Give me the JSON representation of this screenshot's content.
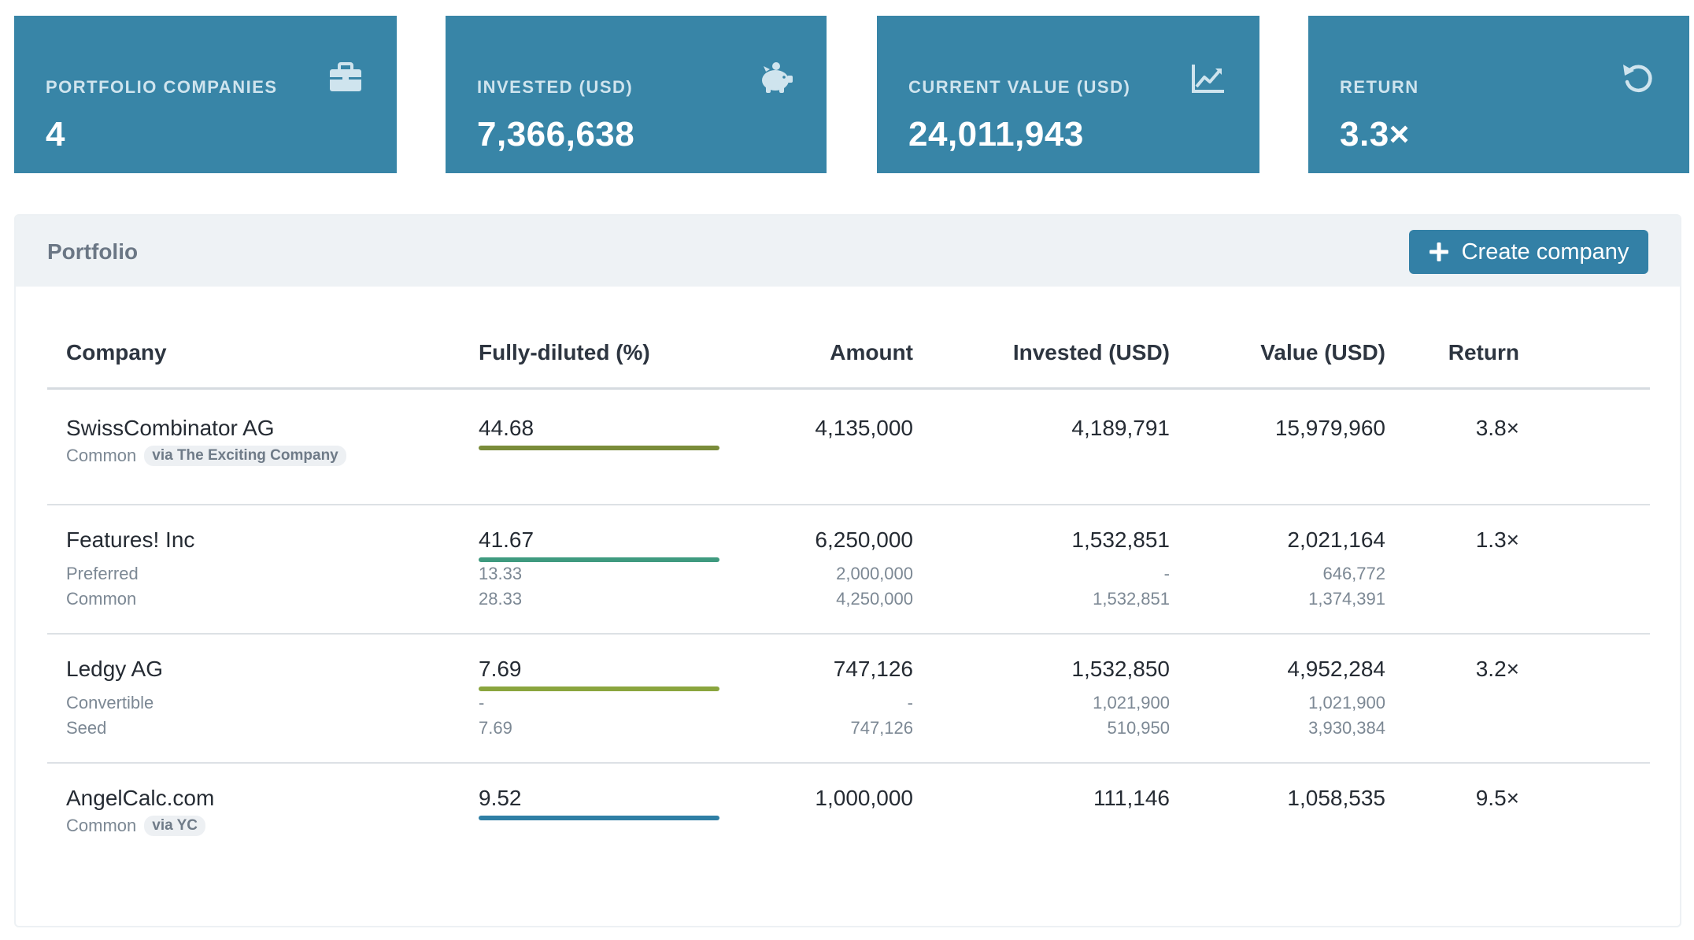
{
  "stats": {
    "companies": {
      "label": "PORTFOLIO COMPANIES",
      "value": "4",
      "icon": "briefcase-icon"
    },
    "invested": {
      "label": "INVESTED (USD)",
      "value": "7,366,638",
      "icon": "piggy-bank-icon"
    },
    "current": {
      "label": "CURRENT VALUE (USD)",
      "value": "24,011,943",
      "icon": "area-chart-icon"
    },
    "ret": {
      "label": "RETURN",
      "value": "3.3×",
      "icon": "refresh-icon"
    }
  },
  "portfolio": {
    "title": "Portfolio",
    "create_label": "Create company",
    "columns": {
      "company": "Company",
      "fd": "Fully-diluted (%)",
      "amount": "Amount",
      "invested": "Invested (USD)",
      "value": "Value (USD)",
      "ret": "Return"
    },
    "rows": [
      {
        "name": "SwissCombinator AG",
        "fd": "44.68",
        "fd_fraction": 0.4468,
        "bar_color": "#7a8c3a",
        "amount": "4,135,000",
        "invested": "4,189,791",
        "value": "15,979,960",
        "ret": "3.8×",
        "sub": [
          {
            "label": "Common",
            "via": "via The Exciting Company"
          }
        ]
      },
      {
        "name": "Features! Inc",
        "fd": "41.67",
        "fd_fraction": 0.4167,
        "bar_color": "#3f9a7f",
        "amount": "6,250,000",
        "invested": "1,532,851",
        "value": "2,021,164",
        "ret": "1.3×",
        "sub": [
          {
            "label": "Preferred",
            "fd": "13.33",
            "amount": "2,000,000",
            "invested": "-",
            "value": "646,772"
          },
          {
            "label": "Common",
            "fd": "28.33",
            "amount": "4,250,000",
            "invested": "1,532,851",
            "value": "1,374,391"
          }
        ]
      },
      {
        "name": "Ledgy AG",
        "fd": "7.69",
        "fd_fraction": 0.0769,
        "bar_color": "#8aa53e",
        "amount": "747,126",
        "invested": "1,532,850",
        "value": "4,952,284",
        "ret": "3.2×",
        "sub": [
          {
            "label": "Convertible",
            "fd": "-",
            "amount": "-",
            "invested": "1,021,900",
            "value": "1,021,900"
          },
          {
            "label": "Seed",
            "fd": "7.69",
            "amount": "747,126",
            "invested": "510,950",
            "value": "3,930,384"
          }
        ]
      },
      {
        "name": "AngelCalc.com",
        "fd": "9.52",
        "fd_fraction": 0.0952,
        "bar_color": "#2f7fa5",
        "amount": "1,000,000",
        "invested": "111,146",
        "value": "1,058,535",
        "ret": "9.5×",
        "sub": [
          {
            "label": "Common",
            "via": "via YC"
          }
        ]
      }
    ]
  }
}
